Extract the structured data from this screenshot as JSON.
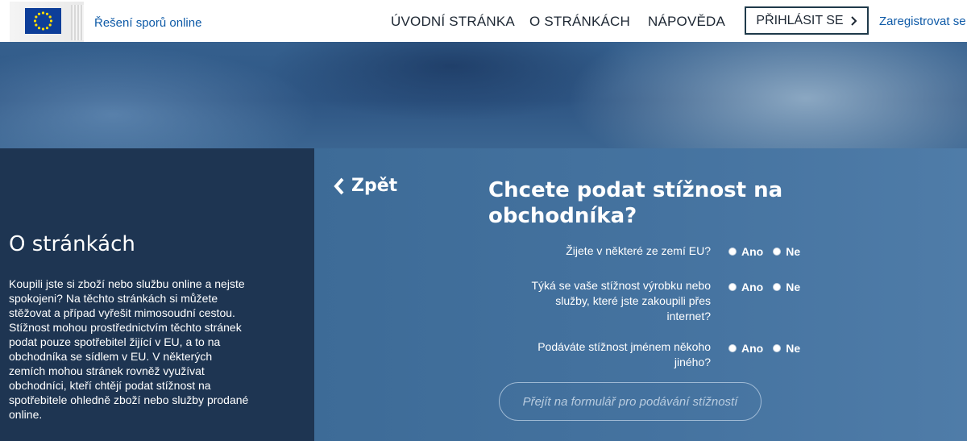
{
  "header": {
    "site_name": "Řešení sporů online",
    "nav": {
      "home": "ÚVODNÍ STRÁNKA",
      "about": "O STRÁNKÁCH",
      "help": "NÁPOVĚDA"
    },
    "login_label": "PŘIHLÁSIT SE",
    "register_label": "Zaregistrovat se"
  },
  "sidebar": {
    "title": "O stránkách",
    "text": "Koupili jste si zboží nebo službu online a nejste spokojeni? Na těchto stránkách si můžete stěžovat a případ vyřešit mimosoudní cestou. Stížnost mohou prostřednictvím těchto stránek podat pouze spotřebitel žijící v EU, a to na obchodníka se sídlem v EU. V některých zemích mohou stránek rovněž využívat obchodníci, kteří chtějí podat stížnost na spotřebitele ohledně zboží nebo služby prodané online."
  },
  "main": {
    "back_label": "Zpět",
    "title": "Chcete podat stížnost na obchodníka?",
    "questions": [
      {
        "label": "Žijete v některé ze zemí EU?",
        "yes": "Ano",
        "no": "Ne"
      },
      {
        "label": "Týká se vaše stížnost výrobku nebo služby, které jste zakoupili přes internet?",
        "yes": "Ano",
        "no": "Ne"
      },
      {
        "label": "Podáváte stížnost jménem někoho jiného?",
        "yes": "Ano",
        "no": "Ne"
      }
    ],
    "submit_label": "Přejít na formulář pro podávání stížností"
  },
  "colors": {
    "header_bg": "#ffffff",
    "link_blue": "#0e5aa7",
    "sidebar_bg": "#1e3552",
    "content_bg": "#4573a0",
    "eu_flag_blue": "#0d3e99",
    "eu_flag_stars": "#ffdd00"
  },
  "icons": {
    "logo": "eu-flag-icon",
    "login_arrow": "chevron-right-icon",
    "back_arrow": "chevron-left-icon",
    "radio": "radio-unchecked-icon"
  }
}
